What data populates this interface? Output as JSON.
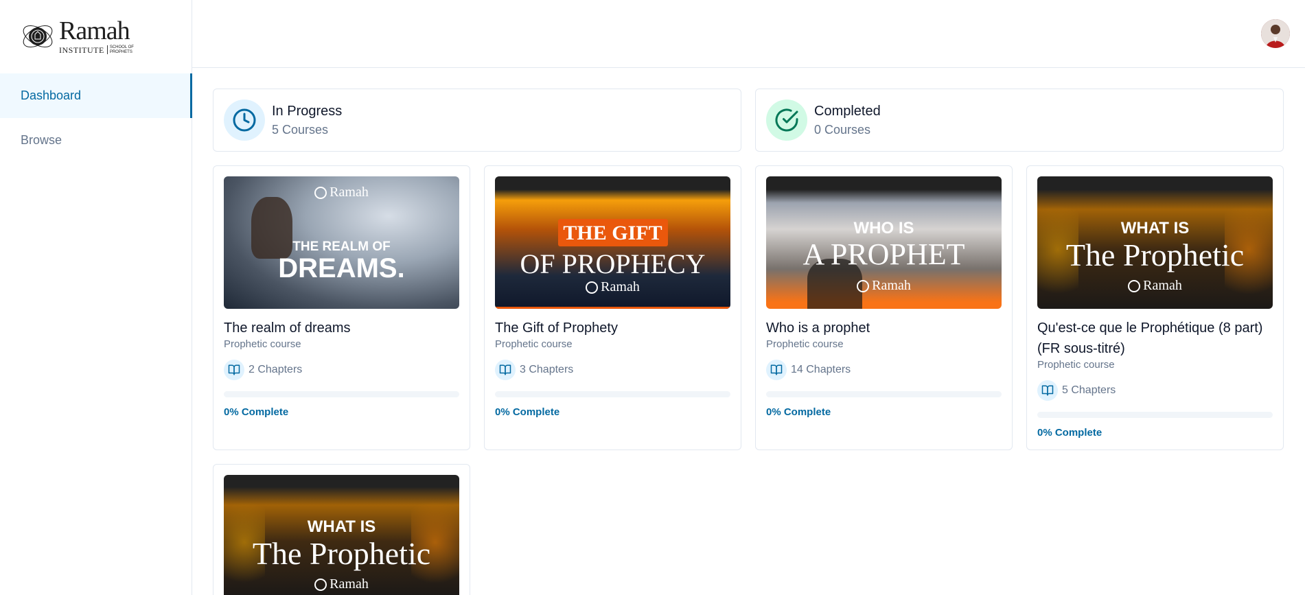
{
  "brand": {
    "name": "Ramah",
    "institute": "INSTITUTE",
    "school": "SCHOOL OF PROPHETS"
  },
  "sidebar": {
    "items": [
      {
        "label": "Dashboard",
        "active": true
      },
      {
        "label": "Browse",
        "active": false
      }
    ]
  },
  "stats": {
    "in_progress": {
      "title": "In Progress",
      "count": "5 Courses"
    },
    "completed": {
      "title": "Completed",
      "count": "0 Courses"
    }
  },
  "courses": [
    {
      "title": "The realm of dreams",
      "category": "Prophetic course",
      "chapters": "2 Chapters",
      "progress_label": "0% Complete",
      "progress": 0,
      "thumb": {
        "line1": "THE REALM OF",
        "line2": "DREAMS.",
        "brand": "Ramah"
      }
    },
    {
      "title": "The Gift of Prophety",
      "category": "Prophetic course",
      "chapters": "3 Chapters",
      "progress_label": "0% Complete",
      "progress": 0,
      "thumb": {
        "line1": "THE GIFT",
        "line2": "OF PROPHECY",
        "brand": "Ramah"
      }
    },
    {
      "title": "Who is a prophet",
      "category": "Prophetic course",
      "chapters": "14 Chapters",
      "progress_label": "0% Complete",
      "progress": 0,
      "thumb": {
        "line1": "WHO IS",
        "line2": "A PROPHET",
        "brand": "Ramah"
      }
    },
    {
      "title": "Qu'est-ce que le Prophétique (8 part) (FR sous-titré)",
      "category": "Prophetic course",
      "chapters": "5 Chapters",
      "progress_label": "0% Complete",
      "progress": 0,
      "thumb": {
        "line1": "WHAT IS",
        "line2": "The Prophetic",
        "brand": "Ramah"
      }
    },
    {
      "thumb": {
        "line1": "WHAT IS",
        "line2": "The Prophetic",
        "brand": "Ramah"
      }
    }
  ],
  "colors": {
    "accent": "#0369a1",
    "success": "#059669",
    "muted": "#64748b"
  }
}
